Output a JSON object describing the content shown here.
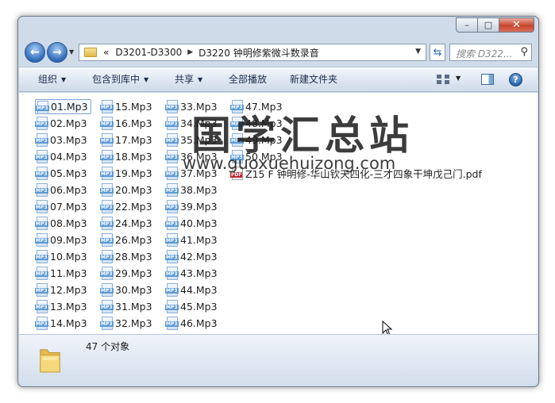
{
  "window": {
    "controls": {
      "minimize": "–",
      "maximize": "□",
      "close": "✕"
    }
  },
  "navigation": {
    "back_icon": "back-arrow-icon",
    "forward_icon": "forward-arrow-icon",
    "breadcrumb": {
      "overflow": "«",
      "segments": [
        "D3201-D3300",
        "D3220 钟明修紫微斗数录音"
      ]
    },
    "search_placeholder": "搜索 D322..."
  },
  "toolbar": {
    "organize": "组织",
    "include_in_library": "包含到库中",
    "share": "共享",
    "play_all": "全部播放",
    "new_folder": "新建文件夹"
  },
  "files": [
    "01.Mp3",
    "02.Mp3",
    "03.Mp3",
    "04.Mp3",
    "05.Mp3",
    "06.Mp3",
    "07.Mp3",
    "08.Mp3",
    "09.Mp3",
    "10.Mp3",
    "11.Mp3",
    "12.Mp3",
    "13.Mp3",
    "14.Mp3",
    "15.Mp3",
    "16.Mp3",
    "17.Mp3",
    "18.Mp3",
    "19.Mp3",
    "20.Mp3",
    "22.Mp3",
    "24.Mp3",
    "26.Mp3",
    "28.Mp3",
    "29.Mp3",
    "30.Mp3",
    "31.Mp3",
    "32.Mp3",
    "33.Mp3",
    "34.Mp3",
    "35.Mp3",
    "36.Mp3",
    "37.Mp3",
    "38.Mp3",
    "39.Mp3",
    "40.Mp3",
    "41.Mp3",
    "42.Mp3",
    "43.Mp3",
    "44.Mp3",
    "45.Mp3",
    "46.Mp3",
    "47.Mp3",
    "48.Mp3",
    "49.Mp3",
    "50.Mp3",
    "Z15 F 钟明修-华山钦天四化-三才四象干坤戊己门.pdf"
  ],
  "watermark": {
    "chinese": "国学汇总站",
    "url": "www.guoxuehuizong.com"
  },
  "status": {
    "count_text": "47 个对象"
  },
  "colors": {
    "window_frame": "#cfdbe9",
    "selection_border": "#7da2ce",
    "pdf_red": "#c1272d"
  }
}
